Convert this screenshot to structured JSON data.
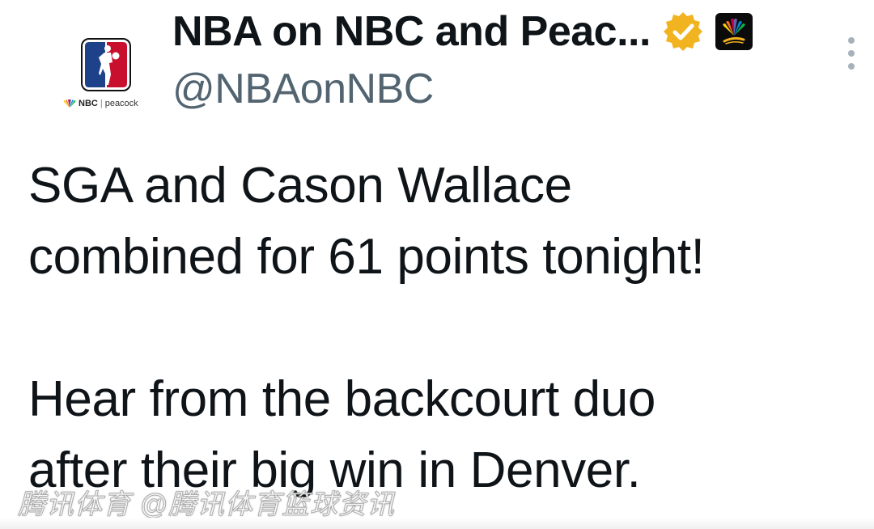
{
  "author": {
    "display_name": "NBA on NBC and Peac...",
    "handle": "@NBAonNBC",
    "avatar_logo": "nba-logo",
    "avatar_brand": {
      "nbc_label": "NBC",
      "separator": "|",
      "peacock_label": "peacock"
    },
    "verified_badge_color": "#f2b320",
    "affiliate_badge": "nbc-sports-peacock-logo"
  },
  "tweet": {
    "paragraphs": [
      "SGA and Cason Wallace\ncombined for 61 points tonight!",
      "Hear from the backcourt duo\nafter their big win in Denver."
    ]
  },
  "watermark": {
    "text": "腾讯体育 @腾讯体育篮球资讯"
  },
  "colors": {
    "text_primary": "#0f1419",
    "text_secondary": "#536471",
    "nba_blue": "#1d428a",
    "nba_red": "#c8102e",
    "verified_gold": "#f2b320"
  }
}
